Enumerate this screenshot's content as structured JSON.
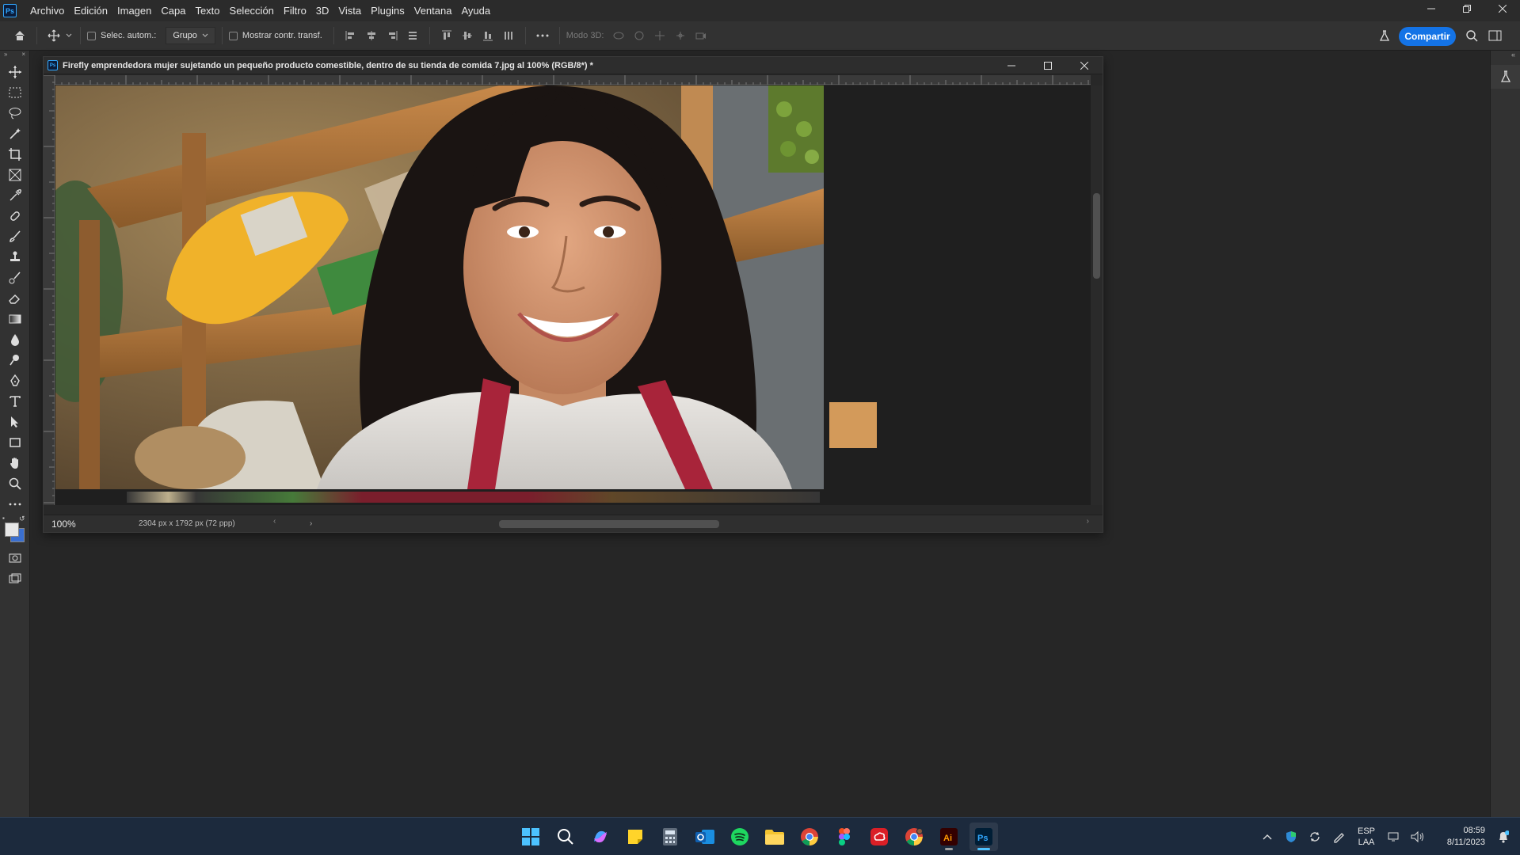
{
  "app": {
    "logo_text": "Ps"
  },
  "menubar": {
    "items": [
      "Archivo",
      "Edición",
      "Imagen",
      "Capa",
      "Texto",
      "Selección",
      "Filtro",
      "3D",
      "Vista",
      "Plugins",
      "Ventana",
      "Ayuda"
    ]
  },
  "options": {
    "auto_select_label": "Selec. autom.:",
    "group_value": "Grupo",
    "show_transform_label": "Mostrar contr. transf.",
    "mode3d_label": "Modo 3D:",
    "share_label": "Compartir"
  },
  "document": {
    "title": "Firefly emprendedora mujer sujetando un pequeño producto comestible, dentro de su tienda de comida 7.jpg al 100% (RGB/8*) *",
    "zoom": "100%",
    "dimensions": "2304 px x 1792 px (72 ppp)"
  },
  "taskbar": {
    "apps": [
      "windows-start",
      "search",
      "copilot",
      "sticky-notes",
      "calculator",
      "outlook",
      "spotify",
      "file-explorer",
      "chrome",
      "figma",
      "creative-cloud",
      "chrome-profile",
      "illustrator",
      "photoshop"
    ],
    "active_app": "photoshop",
    "language": {
      "line1": "ESP",
      "line2": "LAA"
    },
    "clock": {
      "time": "08:59",
      "date": "8/11/2023"
    }
  },
  "colors": {
    "accent": "#1473e6",
    "foreground_swatch": "#e7e7e7",
    "background_swatch": "#3a6fd0"
  }
}
